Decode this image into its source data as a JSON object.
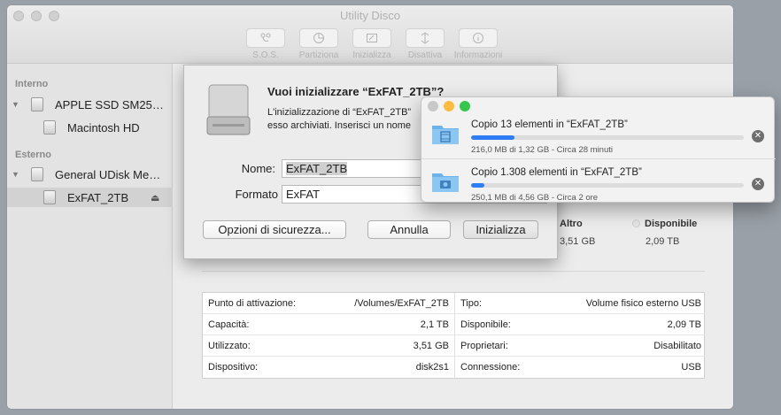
{
  "window": {
    "title": "Utility Disco"
  },
  "toolbar": [
    {
      "label": "S.O.S.",
      "icon": "stethoscope-icon"
    },
    {
      "label": "Partiziona",
      "icon": "partition-icon"
    },
    {
      "label": "Inizializza",
      "icon": "erase-icon"
    },
    {
      "label": "Disattiva",
      "icon": "unmount-icon"
    },
    {
      "label": "Informazioni",
      "icon": "info-icon"
    }
  ],
  "sidebar": {
    "internal_header": "Interno",
    "external_header": "Esterno",
    "items": [
      {
        "label": "APPLE SSD SM25…"
      },
      {
        "label": "Macintosh HD"
      },
      {
        "label": "General UDisk Me…"
      },
      {
        "label": "ExFAT_2TB"
      }
    ]
  },
  "usage": [
    {
      "label": "Altro",
      "value": "3,51 GB"
    },
    {
      "label": "Disponibile",
      "value": "2,09 TB"
    }
  ],
  "info": {
    "left": [
      {
        "key": "Punto di attivazione:",
        "value": "/Volumes/ExFAT_2TB"
      },
      {
        "key": "Capacità:",
        "value": "2,1 TB"
      },
      {
        "key": "Utilizzato:",
        "value": "3,51 GB"
      },
      {
        "key": "Dispositivo:",
        "value": "disk2s1"
      }
    ],
    "right": [
      {
        "key": "Tipo:",
        "value": "Volume fisico esterno USB"
      },
      {
        "key": "Disponibile:",
        "value": "2,09 TB"
      },
      {
        "key": "Proprietari:",
        "value": "Disabilitato"
      },
      {
        "key": "Connessione:",
        "value": "USB"
      }
    ]
  },
  "dialog": {
    "title": "Vuoi inizializzare “ExFAT_2TB”?",
    "text_line1": "L'inizializzazione di “ExFAT_2TB”",
    "text_line2": "esso archiviati. Inserisci un nome",
    "name_label": "Nome:",
    "name_value": "ExFAT_2TB",
    "format_label": "Formato",
    "format_value": "ExFAT",
    "security_button": "Opzioni di sicurezza...",
    "cancel_button": "Annulla",
    "erase_button": "Inizializza"
  },
  "copy": {
    "items": [
      {
        "title": "Copio 13 elementi in “ExFAT_2TB”",
        "detail": "216,0 MB di 1,32 GB - Circa 28 minuti",
        "progress": 0.16,
        "icon": "movies-folder-icon"
      },
      {
        "title": "Copio 1.308 elementi in “ExFAT_2TB”",
        "detail": "250,1 MB di 4,56 GB - Circa 2 ore",
        "progress": 0.05,
        "icon": "photos-folder-icon"
      }
    ],
    "colors": {
      "close": "#fc605c",
      "minimize": "#fdbc40",
      "zoom": "#34c84a",
      "progress": "#2e7cf6"
    }
  }
}
